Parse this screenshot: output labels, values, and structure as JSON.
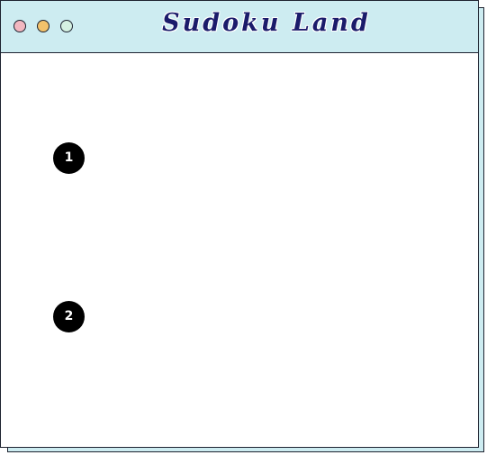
{
  "window": {
    "title": "Sudoku Land",
    "controls": {
      "close_color": "#f2b7c0",
      "minimize_color": "#f3c26b",
      "maximize_color": "#d5f1e2"
    },
    "accent_color": "#cdecf1",
    "title_color": "#1b1b6b"
  },
  "markers": [
    {
      "label": "1"
    },
    {
      "label": "2"
    }
  ]
}
